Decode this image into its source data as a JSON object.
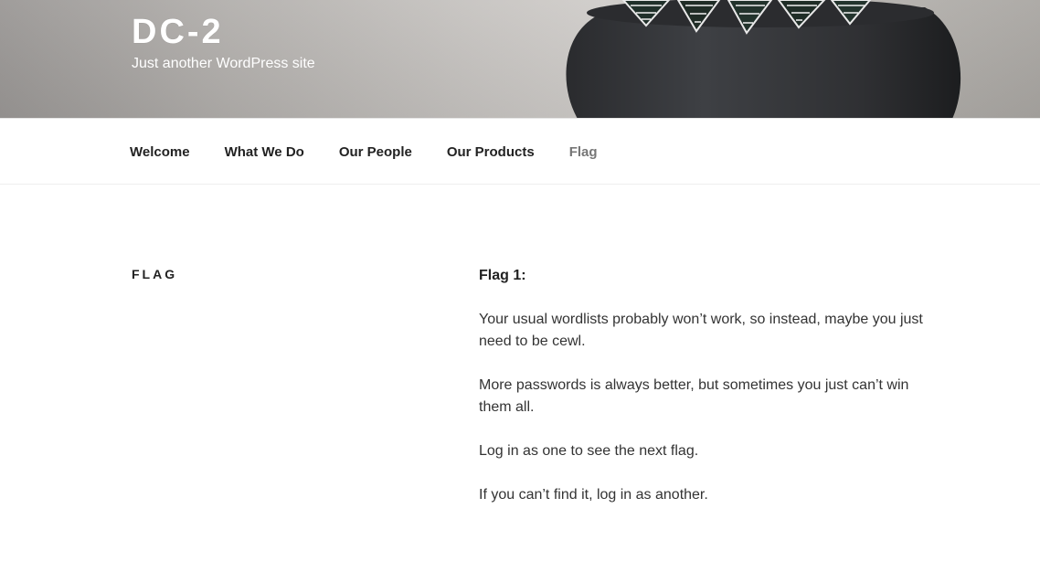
{
  "header": {
    "site_title": "DC-2",
    "tagline": "Just another WordPress site"
  },
  "nav": {
    "items": [
      {
        "label": "Welcome"
      },
      {
        "label": "What We Do"
      },
      {
        "label": "Our People"
      },
      {
        "label": "Our Products"
      },
      {
        "label": "Flag"
      }
    ],
    "current": "Flag"
  },
  "page": {
    "title": "Flag",
    "content": {
      "heading": "Flag 1:",
      "paragraphs": [
        "Your usual wordlists probably won’t work, so instead, maybe you just need to be cewl.",
        "More passwords is always better, but sometimes you just can’t win them all.",
        "Log in as one to see the next flag.",
        "If you can’t find it, log in as another."
      ]
    }
  },
  "colors": {
    "text": "#222222",
    "muted_nav": "#767676",
    "body_text": "#333333",
    "header_text": "#ffffff"
  }
}
